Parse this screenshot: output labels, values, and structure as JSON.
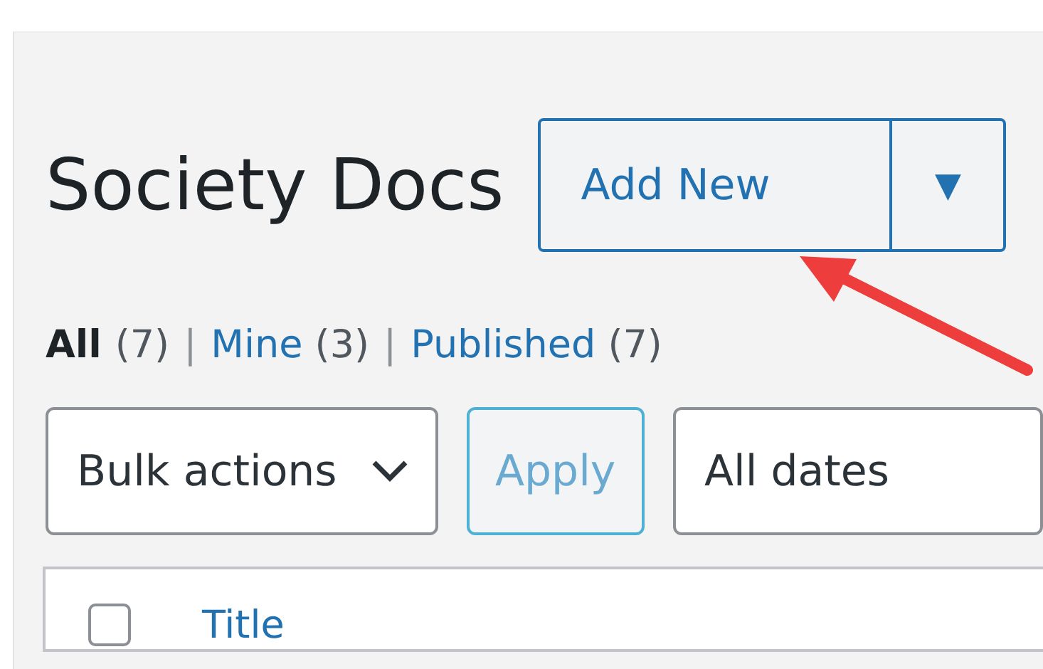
{
  "heading": {
    "title": "Society Docs",
    "add_button": "Add New",
    "dropdown_icon": "▼"
  },
  "filters": [
    {
      "label": "All",
      "count": "(7)",
      "selected": true
    },
    {
      "separator": "|",
      "label": "Mine",
      "count": "(3)",
      "selected": false
    },
    {
      "separator": "|",
      "label": "Published",
      "count": "(7)",
      "selected": false
    }
  ],
  "toolbar": {
    "bulk_actions": "Bulk actions",
    "apply": "Apply",
    "date_filter": "All dates"
  },
  "table": {
    "select_all": {
      "checked": false
    },
    "columns": [
      "Title"
    ]
  }
}
